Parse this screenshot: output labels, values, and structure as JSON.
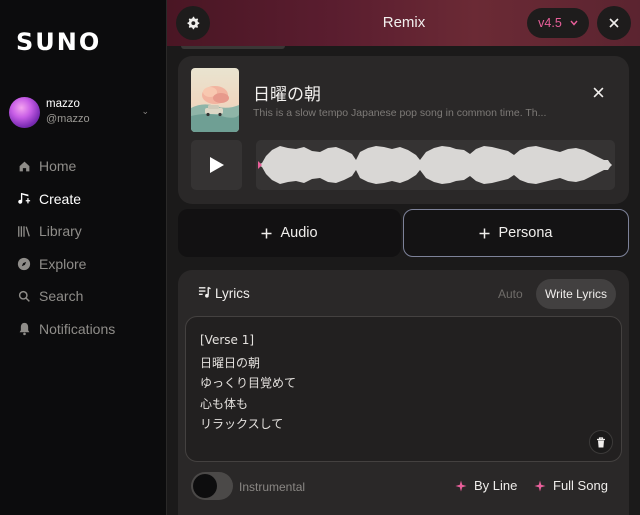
{
  "sidebar": {
    "logo": "SUNO",
    "user": {
      "name": "mazzo",
      "handle": "@mazzo"
    },
    "nav": [
      {
        "label": "Home",
        "icon": "home-icon",
        "active": false
      },
      {
        "label": "Create",
        "icon": "music-note-icon",
        "active": true
      },
      {
        "label": "Library",
        "icon": "library-icon",
        "active": false
      },
      {
        "label": "Explore",
        "icon": "compass-icon",
        "active": false
      },
      {
        "label": "Search",
        "icon": "search-icon",
        "active": false
      },
      {
        "label": "Notifications",
        "icon": "bell-icon",
        "active": false
      }
    ]
  },
  "header": {
    "title": "Remix",
    "version": "v4.5"
  },
  "track": {
    "title": "日曜の朝",
    "description": "This is a slow tempo Japanese pop song in common time. Th...",
    "cover_icon": "album-cover-image"
  },
  "buttons": {
    "audio": "Audio",
    "persona": "Persona"
  },
  "lyrics": {
    "label": "Lyrics",
    "mode_auto": "Auto",
    "mode_write": "Write Lyrics",
    "lines": [
      "[Verse 1]",
      "日曜日の朝",
      "ゆっくり目覚めて",
      "心も体も",
      "リラックスして"
    ],
    "instrumental_label": "Instrumental",
    "instrumental_on": false,
    "by_line": "By Line",
    "full_song": "Full Song"
  },
  "colors": {
    "accent_pink": "#e85f9a",
    "header_gradient": "#5a1d2f",
    "persona_border": "#7d8299"
  }
}
